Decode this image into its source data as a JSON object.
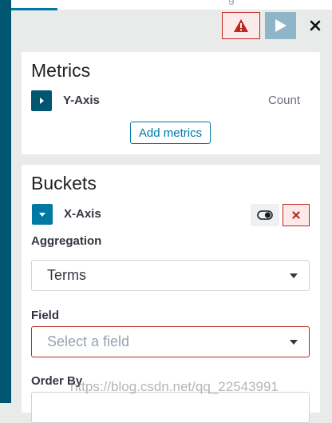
{
  "header": {
    "partial_tab_text": "g"
  },
  "toolbar": {
    "warning_icon": "warning-triangle-icon",
    "run_icon": "play-icon",
    "close_icon": "close-icon"
  },
  "metrics": {
    "title": "Metrics",
    "y_axis": {
      "label": "Y-Axis",
      "aggregation": "Count"
    },
    "add_button_label": "Add metrics"
  },
  "buckets": {
    "title": "Buckets",
    "x_axis": {
      "label": "X-Axis"
    },
    "aggregation": {
      "label": "Aggregation",
      "value": "Terms"
    },
    "field": {
      "label": "Field",
      "placeholder": "Select a field"
    },
    "order_by": {
      "label": "Order By"
    }
  },
  "watermark": "https://blog.csdn.net/qq_22543991",
  "colors": {
    "accent": "#0079a5",
    "rail": "#005571",
    "danger": "#bd271e",
    "run_button": "#8fb5c9"
  }
}
